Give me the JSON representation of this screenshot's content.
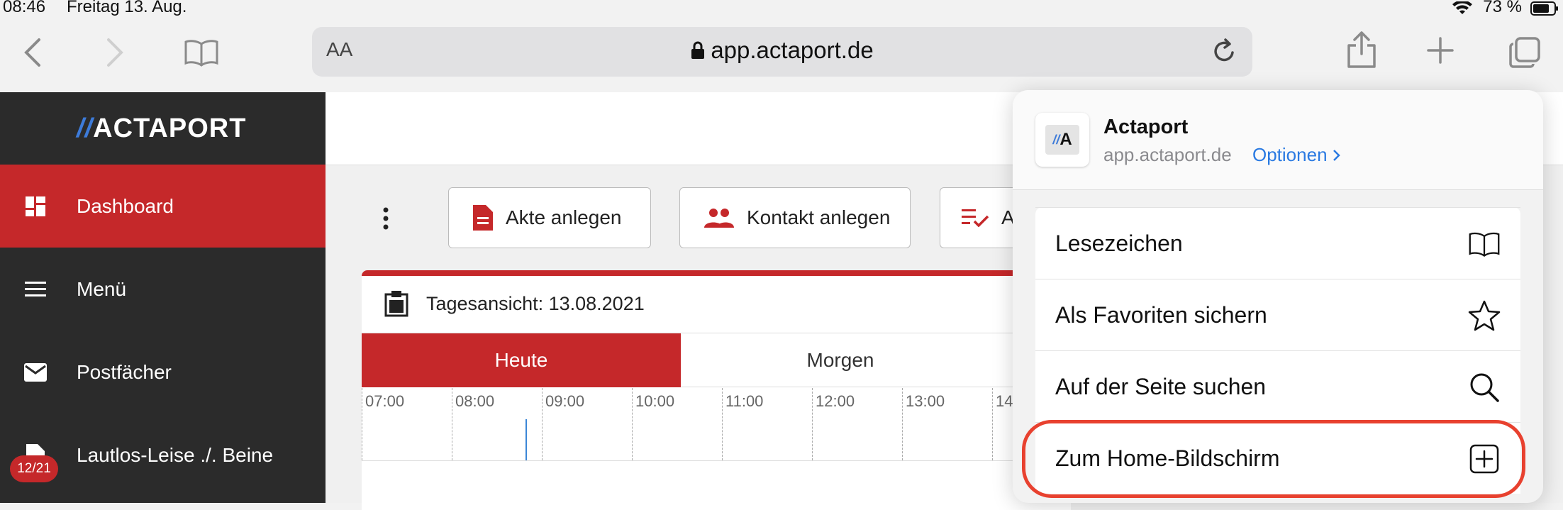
{
  "status_bar": {
    "time": "08:46",
    "date": "Freitag 13. Aug.",
    "battery": "73 %"
  },
  "browser": {
    "text_size_label": "AA",
    "url": "app.actaport.de"
  },
  "sidebar": {
    "logo": "ACTAPORT",
    "items": [
      {
        "label": "Dashboard",
        "icon": "dashboard-icon",
        "active": true
      },
      {
        "label": "Menü",
        "icon": "menu-icon"
      },
      {
        "label": "Postfächer",
        "icon": "mail-icon"
      },
      {
        "label": "Lautlos-Leise ./. Beine",
        "icon": "file-icon"
      }
    ],
    "badge": "12/21"
  },
  "main": {
    "actions": [
      {
        "label": "Akte anlegen",
        "icon": "document-icon"
      },
      {
        "label": "Kontakt anlegen",
        "icon": "people-icon"
      },
      {
        "label": "A",
        "icon": "checklist-icon"
      }
    ],
    "calendar": {
      "title": "Tagesansicht: 13.08.2021",
      "tabs": [
        "Heute",
        "Morgen"
      ],
      "hours": [
        "07:00",
        "08:00",
        "09:00",
        "10:00",
        "11:00",
        "12:00",
        "13:00",
        "14"
      ]
    }
  },
  "share_sheet": {
    "app_name": "Actaport",
    "app_url": "app.actaport.de",
    "options_label": "Optionen",
    "items": [
      {
        "label": "Lesezeichen",
        "icon": "book-icon"
      },
      {
        "label": "Als Favoriten sichern",
        "icon": "star-icon"
      },
      {
        "label": "Auf der Seite suchen",
        "icon": "search-icon"
      },
      {
        "label": "Zum Home-Bildschirm",
        "icon": "add-square-icon"
      }
    ]
  },
  "colors": {
    "brand_red": "#c5282a",
    "sidebar_bg": "#2b2b2b",
    "link_blue": "#2a7ae2",
    "highlight": "#e8412f"
  }
}
